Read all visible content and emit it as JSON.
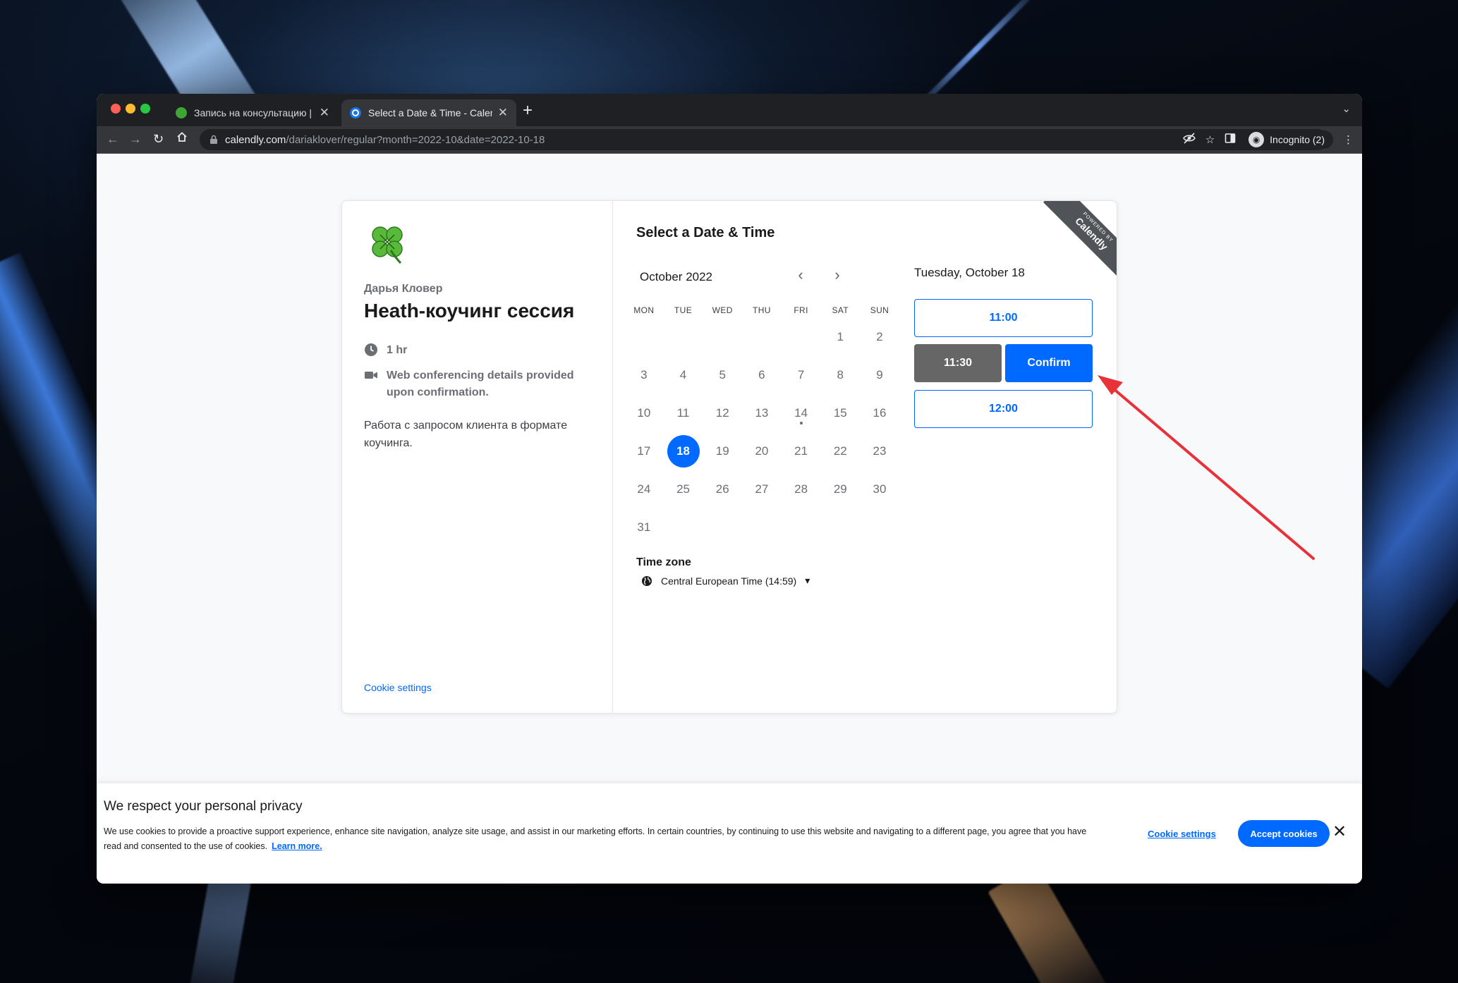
{
  "browser": {
    "tabs": [
      {
        "title": "Запись на консультацию | Дар",
        "active": false
      },
      {
        "title": "Select a Date & Time - Calendl",
        "active": true
      }
    ],
    "url_host": "calendly.com",
    "url_path": "/dariaklover/regular?month=2022-10&date=2022-10-18",
    "profile_label": "Incognito (2)"
  },
  "event": {
    "host_name": "Дарья Кловер",
    "title": "Heath-коучинг сессия",
    "duration": "1 hr",
    "location": "Web conferencing details provided upon confirmation.",
    "description": "Работа с запросом клиента в формате коучинга.",
    "cookie_settings_link": "Cookie settings"
  },
  "scheduler": {
    "heading": "Select a Date & Time",
    "month_label": "October 2022",
    "weekdays": [
      "MON",
      "TUE",
      "WED",
      "THU",
      "FRI",
      "SAT",
      "SUN"
    ],
    "weeks": [
      [
        "",
        "",
        "",
        "",
        "",
        "1",
        "2"
      ],
      [
        "3",
        "4",
        "5",
        "6",
        "7",
        "8",
        "9"
      ],
      [
        "10",
        "11",
        "12",
        "13",
        "14",
        "15",
        "16"
      ],
      [
        "17",
        "18",
        "19",
        "20",
        "21",
        "22",
        "23"
      ],
      [
        "24",
        "25",
        "26",
        "27",
        "28",
        "29",
        "30"
      ],
      [
        "31",
        "",
        "",
        "",
        "",
        "",
        ""
      ]
    ],
    "today": "14",
    "selected_day": "18",
    "timezone_label": "Time zone",
    "timezone_value": "Central European Time (14:59)",
    "selected_date_heading": "Tuesday, October 18",
    "slots": {
      "first": "11:00",
      "selected": "11:30",
      "confirm": "Confirm",
      "last": "12:00"
    },
    "ribbon": {
      "small": "POWERED BY",
      "big": "Calendly"
    }
  },
  "cookie_banner": {
    "title": "We respect your personal privacy",
    "text": "We use cookies to provide a proactive support experience, enhance site navigation, analyze site usage, and assist in our marketing efforts. In certain countries, by continuing to use this website and navigating to a different page, you agree that you have read and consented to the use of cookies.",
    "learn_more": "Learn more.",
    "settings": "Cookie settings",
    "accept": "Accept cookies"
  },
  "colors": {
    "brand_blue": "#0069ff",
    "selected_slot_gray": "#666666",
    "annotation_red": "#e8323a"
  }
}
